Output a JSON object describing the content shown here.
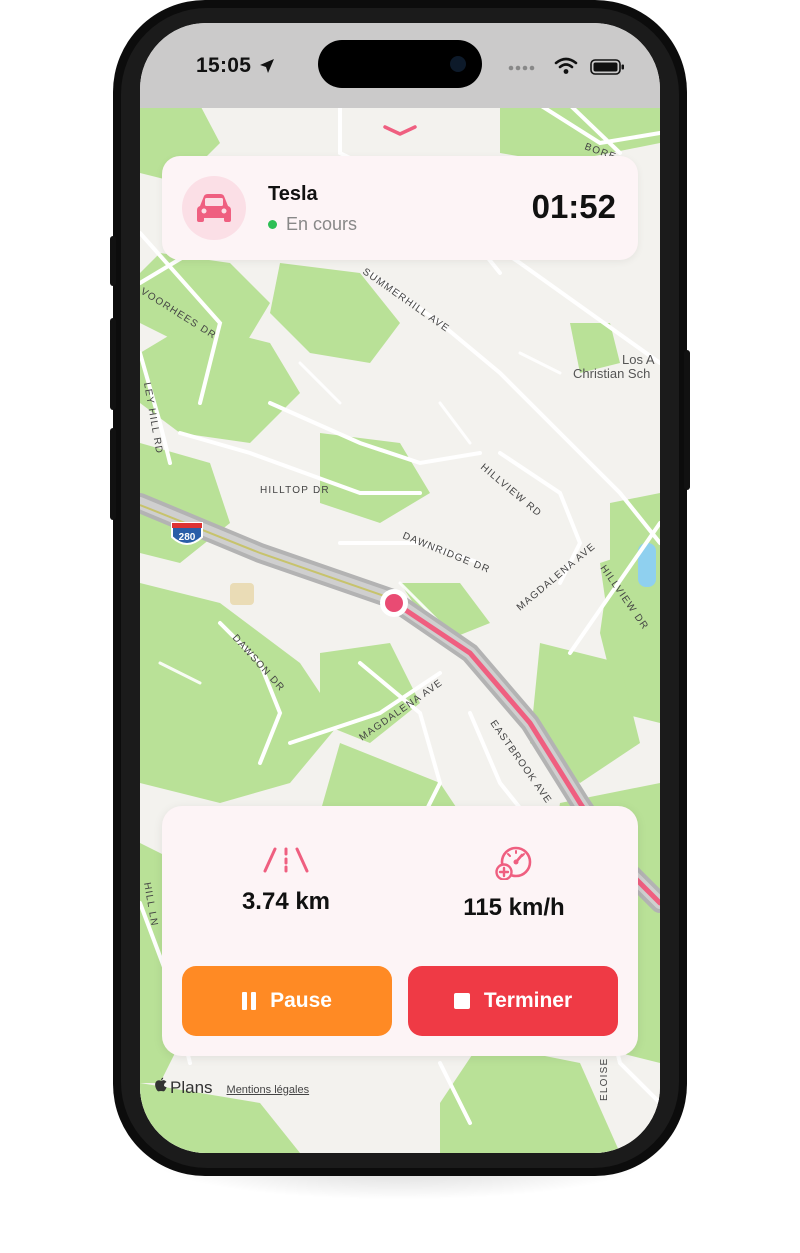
{
  "status_bar": {
    "time": "15:05",
    "icons": [
      "location-arrow-icon",
      "cellular-signal-icon",
      "wifi-icon",
      "battery-icon"
    ]
  },
  "trip_card": {
    "vehicle_name": "Tesla",
    "status": "En cours",
    "elapsed_time": "01:52",
    "icon": "car-icon"
  },
  "stats": {
    "distance": "3.74 km",
    "speed": "115 km/h",
    "distance_icon": "road-icon",
    "speed_icon": "speedometer-icon"
  },
  "actions": {
    "pause_label": "Pause",
    "stop_label": "Terminer"
  },
  "map": {
    "attribution": "Plans",
    "legal_link": "Mentions légales",
    "labels": [
      "SUMMERHILL AVE",
      "VOORHEES DR",
      "HILLTOP DR",
      "DAWNRIDGE DR",
      "HILLVIEW RD",
      "MAGDALENA AVE",
      "HILLVIEW DR",
      "DAWSON DR",
      "EASTBROOK AVE",
      "ELOISE",
      "BORE",
      "Los A",
      "Christian Sch",
      "LEY HILL RD",
      "HILL LN",
      "280"
    ],
    "colors": {
      "route": "#ef5f80",
      "position_marker": "#e94b73",
      "park": "#b5e08f"
    }
  },
  "colors": {
    "accent": "#ef4a6e",
    "pause": "#ff8a24",
    "stop": "#ef3a45",
    "status_ok": "#2dbf55"
  }
}
